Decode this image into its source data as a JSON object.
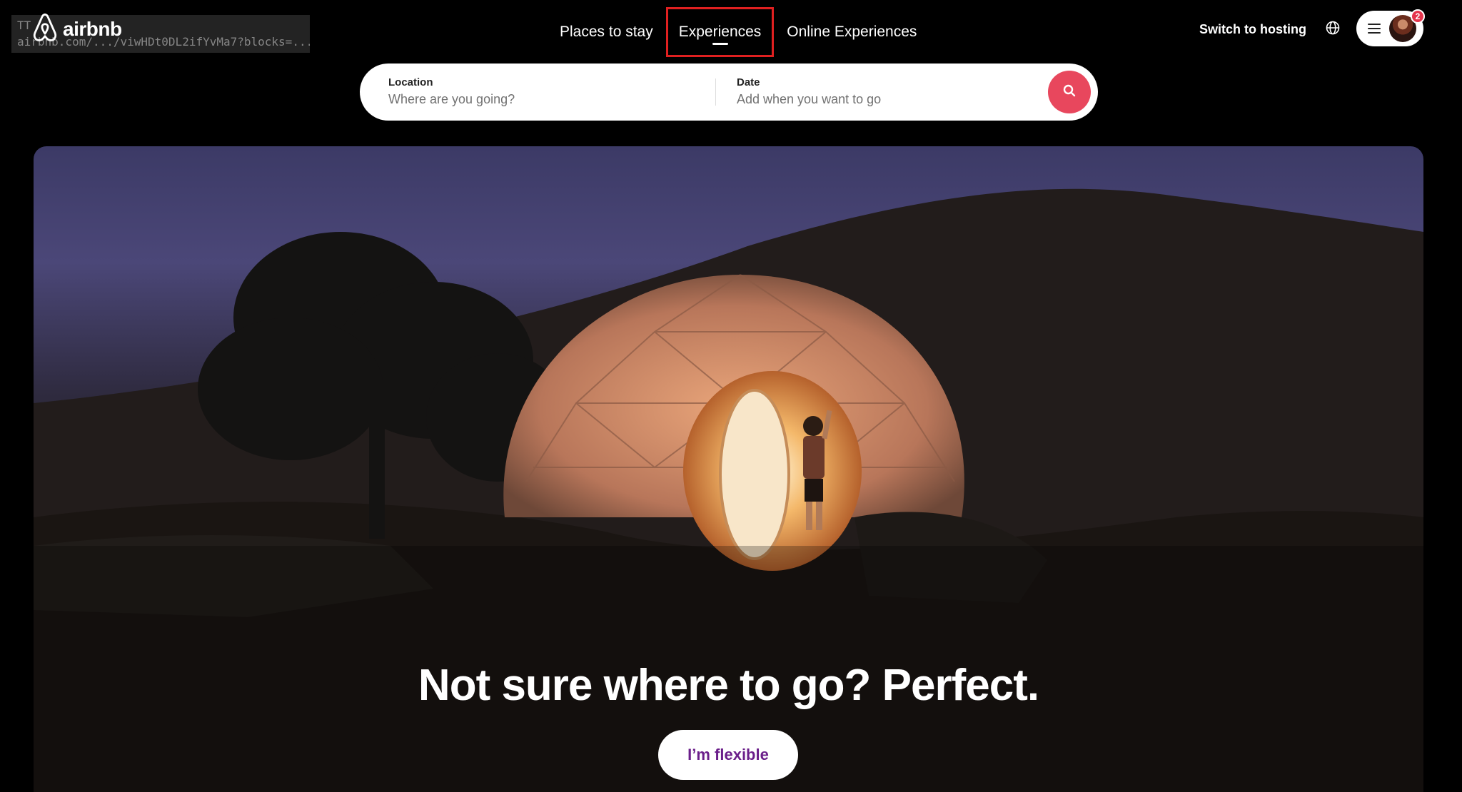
{
  "browser": {
    "url_overlay_line1": "TT",
    "url_overlay_line2": "airbnb.com/.../viwHDt0DL2ifYvMa7?blocks=..."
  },
  "header": {
    "logo_text": "airbnb",
    "nav_tabs": [
      {
        "label": "Places to stay",
        "active": false
      },
      {
        "label": "Experiences",
        "active": true
      },
      {
        "label": "Online Experiences",
        "active": false
      }
    ],
    "host_link": "Switch to hosting",
    "notification_count": "2"
  },
  "search": {
    "location_label": "Location",
    "location_placeholder": "Where are you going?",
    "date_label": "Date",
    "date_placeholder": "Add when you want to go"
  },
  "hero": {
    "title": "Not sure where to go? Perfect.",
    "cta_label": "I’m flexible"
  },
  "colors": {
    "brand": "#FF385C",
    "search_button": "#E8475D",
    "cta_text": "#6B1F8A",
    "active_tab_highlight": "#E02020"
  },
  "icons": [
    "airbnb-logo-icon",
    "globe-icon",
    "hamburger-icon",
    "search-icon"
  ]
}
